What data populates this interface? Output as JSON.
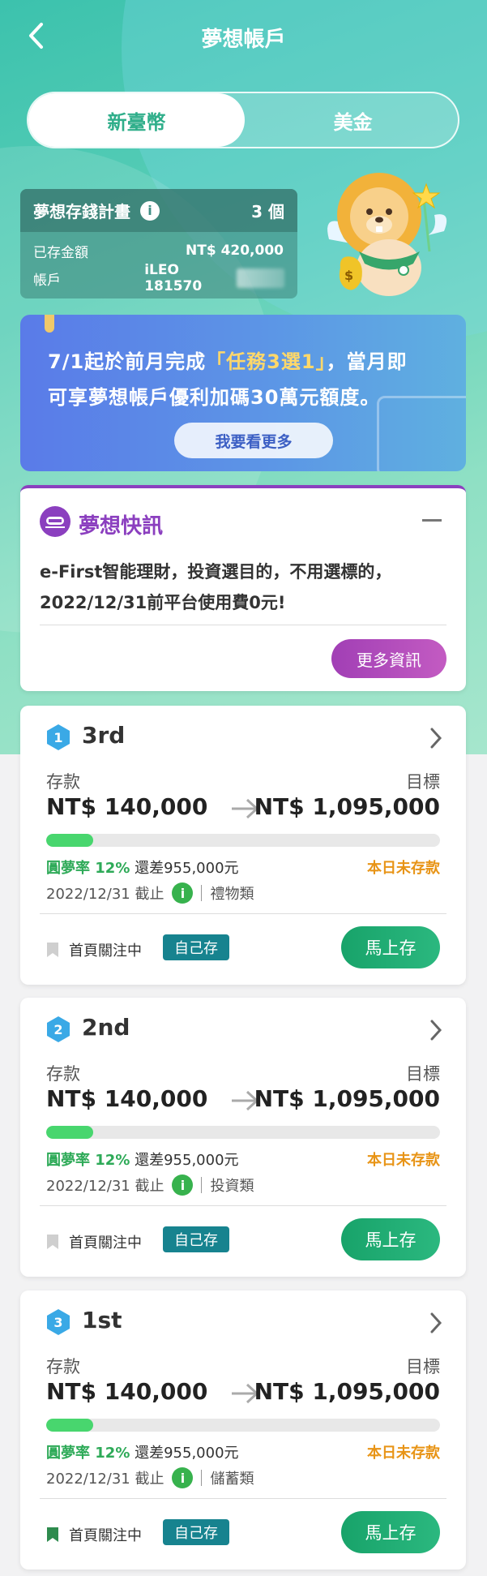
{
  "header": {
    "title": "夢想帳戶"
  },
  "currency_tabs": [
    {
      "label": "新臺幣",
      "active": true
    },
    {
      "label": "美金",
      "active": false
    }
  ],
  "plan": {
    "title": "夢想存錢計畫",
    "count": "3 個",
    "saved_label": "已存金額",
    "saved_value": "NT$ 420,000",
    "account_label": "帳戶",
    "account_value": "iLEO 181570"
  },
  "promo": {
    "line1_prefix": "7/1起於前月完成",
    "line1_highlight": "「任務3選1」",
    "line1_suffix": "，當月即",
    "line2": "可享夢想帳戶優利加碼30萬元額度。",
    "button": "我要看更多"
  },
  "news": {
    "title": "夢想快訊",
    "body_line1": "e-First智能理財，投資選目的，不用選標的，",
    "body_line2": "2022/12/31前平台使用費0元!",
    "more_button": "更多資訊"
  },
  "goals": [
    {
      "badge": "1",
      "rank": "3rd",
      "deposit_label": "存款",
      "target_label": "目標",
      "deposit": "NT$ 140,000",
      "target": "NT$ 1,095,000",
      "progress": 0.12,
      "rate_label": "圓夢率 12%",
      "remaining": "還差955,000元",
      "status": "本日未存款",
      "deadline": "2022/12/31 截止",
      "category": "禮物類",
      "pin_label": "首頁關注中",
      "pinned": false,
      "tag": "自己存",
      "cta": "馬上存"
    },
    {
      "badge": "2",
      "rank": "2nd",
      "deposit_label": "存款",
      "target_label": "目標",
      "deposit": "NT$ 140,000",
      "target": "NT$ 1,095,000",
      "progress": 0.12,
      "rate_label": "圓夢率 12%",
      "remaining": "還差955,000元",
      "status": "本日未存款",
      "deadline": "2022/12/31 截止",
      "category": "投資類",
      "pin_label": "首頁關注中",
      "pinned": false,
      "tag": "自己存",
      "cta": "馬上存"
    },
    {
      "badge": "3",
      "rank": "1st",
      "deposit_label": "存款",
      "target_label": "目標",
      "deposit": "NT$ 140,000",
      "target": "NT$ 1,095,000",
      "progress": 0.12,
      "rate_label": "圓夢率 12%",
      "remaining": "還差955,000元",
      "status": "本日未存款",
      "deadline": "2022/12/31 截止",
      "category": "儲蓄類",
      "pin_label": "首頁關注中",
      "pinned": true,
      "tag": "自己存",
      "cta": "馬上存"
    }
  ],
  "colors": {
    "accent": "#2fae8a",
    "promo_blue": "#5a7be8",
    "news_purple": "#8b3fbf",
    "cta_green": "#18a36a",
    "warn_orange": "#e89416",
    "progress_green": "#48d66e"
  }
}
